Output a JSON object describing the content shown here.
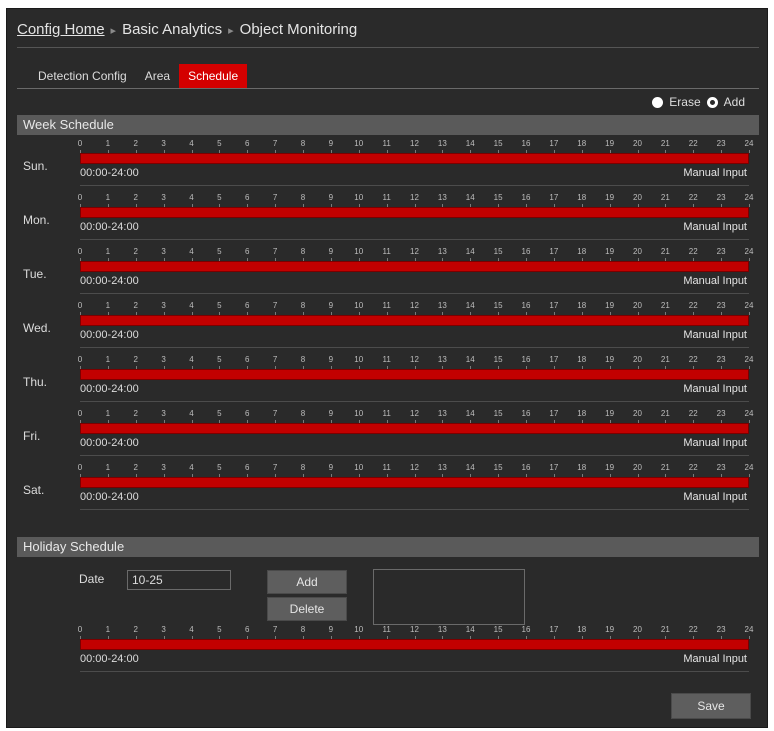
{
  "breadcrumb": {
    "home": "Config Home",
    "level2": "Basic Analytics",
    "level3": "Object Monitoring",
    "separator": "▸"
  },
  "tabs": [
    {
      "label": "Detection Config",
      "active": false
    },
    {
      "label": "Area",
      "active": false
    },
    {
      "label": "Schedule",
      "active": true
    }
  ],
  "mode": {
    "erase_label": "Erase",
    "add_label": "Add",
    "selected": "add"
  },
  "week_schedule": {
    "title": "Week Schedule",
    "hours": [
      "0",
      "1",
      "2",
      "3",
      "4",
      "5",
      "6",
      "7",
      "8",
      "9",
      "10",
      "11",
      "12",
      "13",
      "14",
      "15",
      "16",
      "17",
      "18",
      "19",
      "20",
      "21",
      "22",
      "23",
      "24"
    ],
    "days": [
      {
        "label": "Sun.",
        "range": "00:00-24:00",
        "manual": "Manual Input"
      },
      {
        "label": "Mon.",
        "range": "00:00-24:00",
        "manual": "Manual Input"
      },
      {
        "label": "Tue.",
        "range": "00:00-24:00",
        "manual": "Manual Input"
      },
      {
        "label": "Wed.",
        "range": "00:00-24:00",
        "manual": "Manual Input"
      },
      {
        "label": "Thu.",
        "range": "00:00-24:00",
        "manual": "Manual Input"
      },
      {
        "label": "Fri.",
        "range": "00:00-24:00",
        "manual": "Manual Input"
      },
      {
        "label": "Sat.",
        "range": "00:00-24:00",
        "manual": "Manual Input"
      }
    ]
  },
  "holiday_schedule": {
    "title": "Holiday Schedule",
    "date_label": "Date",
    "date_value": "10-25",
    "add_label": "Add",
    "delete_label": "Delete",
    "range": "00:00-24:00",
    "manual": "Manual Input"
  },
  "save_label": "Save",
  "colors": {
    "accent": "#d40000",
    "bar": "#c20000",
    "panel": "#2a2a2a",
    "header": "#5a5a5a"
  }
}
